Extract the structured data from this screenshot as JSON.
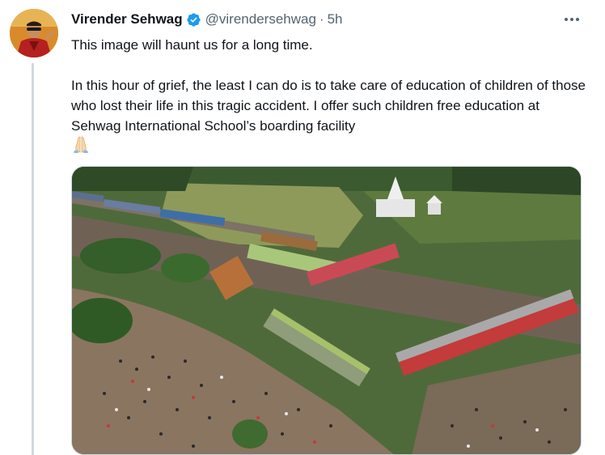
{
  "author": {
    "name": "Virender Sehwag",
    "handle": "@virendersehwag",
    "separator": "·",
    "time": "5h",
    "verified": true
  },
  "tweet": {
    "line1": "This image will haunt us for a long time.",
    "line2": "In this hour of grief, the least I can do is to take care of education of children of those who lost their life in this tragic accident. I offer such children free education at Sehwag International School’s boarding facility",
    "emoji": "folded-hands"
  },
  "icons": {
    "verified": "verified-badge-icon",
    "more": "more-options-icon"
  },
  "colors": {
    "verified": "#1d9bf0",
    "secondary_text": "#536471",
    "thread_line": "#cfd9de"
  },
  "media": {
    "description_kind": "photo"
  }
}
